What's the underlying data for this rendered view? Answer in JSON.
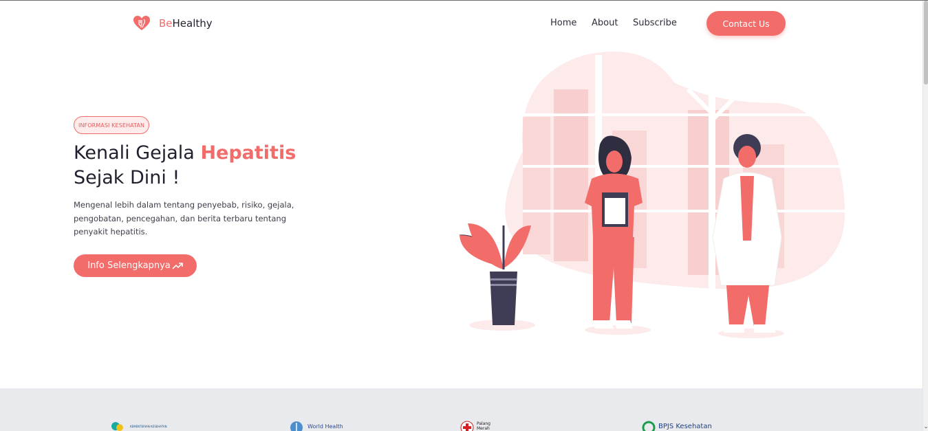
{
  "header": {
    "logo_prefix": "Be",
    "logo_suffix": "Healthy",
    "nav": [
      {
        "label": "Home"
      },
      {
        "label": "About"
      },
      {
        "label": "Subscribe"
      }
    ],
    "contact_label": "Contact Us"
  },
  "hero": {
    "badge": "INFORMASI KESEHATAN",
    "title_part1": "Kenali Gejala ",
    "title_accent": "Hepatitis",
    "title_part2": "Sejak Dini !",
    "description": "Mengenal lebih dalam tentang penyebab, risiko, gejala, pengobatan, pencegahan, dan berita terbaru tentang penyakit hepatitis.",
    "cta_label": "Info Selengkapnya"
  },
  "partners": [
    {
      "name": "Kementerian Kesehatan",
      "label": "KEMENTERIAN KESEHATAN"
    },
    {
      "name": "World Health Organization",
      "label": "World Health"
    },
    {
      "name": "Palang Merah Indonesia",
      "label": "Palang Merah"
    },
    {
      "name": "BPJS Kesehatan",
      "label": "BPJS Kesehatan"
    }
  ],
  "colors": {
    "accent": "#f26c6a",
    "accent_light": "#fdeceb",
    "text_dark": "#1f1f2e",
    "strip_bg": "#e9eaed"
  },
  "icons": [
    "heart-logo-icon",
    "trending-up-icon"
  ]
}
